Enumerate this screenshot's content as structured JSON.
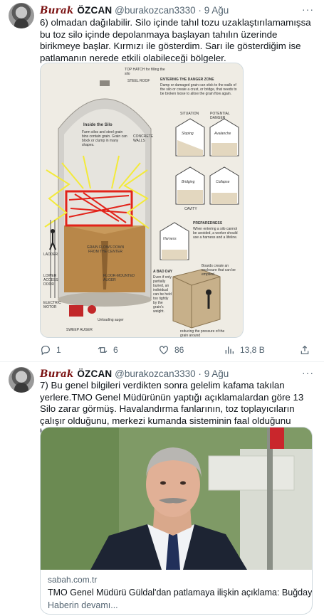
{
  "tweet1": {
    "display_name_styled": "Burak",
    "display_name_plain": "ÖZCAN",
    "handle": "@burakozcan3330",
    "separator": "·",
    "date": "9 Ağu",
    "more": "···",
    "text": "6) olmadan dağılabilir. Silo içinde tahıl tozu uzaklaştırılamamışsa  bu toz silo içinde depolanmaya başlayan tahılın üzerinde birikmeye başlar.  Kırmızı ile gösterdim. Sarı ile gösterdiğim ise patlamanın nerede etkili olabileceği bölgeler.",
    "media": {
      "labels": {
        "top_hatch": "TOP HATCH for filling the silo",
        "steel_roof": "STEEL ROOF",
        "inside": "Inside the Silo",
        "inside_body": "Farm silos and steel grain bins contain grain. Grain can block or clump in many shapes.",
        "concrete": "CONCRETE WALLS",
        "ladder": "LADDER",
        "lower_door": "LOWER ACCESS DOOR",
        "electric": "ELECTRIC MOTOR",
        "auger": "SWEEP AUGER",
        "grain_flows": "GRAIN FLOWS DOWN FROM THE CENTER",
        "floor": "FLOOR-MOUNTED AUGER",
        "unloading": "Unloading auger",
        "entering_title": "ENTERING THE DANGER ZONE",
        "entering_body": "Damp or damaged grain can stick to the walls of the silo or create a crust, or bridge, that needs to be broken loose to allow the grain flow again.",
        "situation": "SITUATION",
        "potential": "POTENTIAL DANGER",
        "sloping": "Sloping",
        "avalanche": "Avalanche",
        "bridging": "Bridging",
        "collapse": "Collapse",
        "cavity": "CAVITY",
        "preparedness_title": "PREPAREDNESS",
        "preparedness_body": "When entering a silo cannot be avoided, a worker should use a harness and a lifeline.",
        "harness": "Harness",
        "bad_day": "A BAD DAY",
        "bad_day_body": "Even if only partially buried, an individual can be held too tightly by the grain's weight.",
        "boards": "Boards create an enclosure that can be emptied.",
        "reducing": "reducing the pressure of the grain around"
      }
    },
    "actions": {
      "replies": "1",
      "retweets": "6",
      "likes": "86",
      "views": "13,8 B"
    }
  },
  "tweet2": {
    "display_name_styled": "Burak",
    "display_name_plain": "ÖZCAN",
    "handle": "@burakozcan3330",
    "separator": "·",
    "date": "9 Ağu",
    "more": "···",
    "text": "7) Bu genel bilgileri verdikten sonra gelelim kafama takılan yerlere.TMO Genel Müdürünün yaptığı açıklamalardan göre  13 Silo zarar görmüş. Havalandırma fanlarının, toz toplayıcıların çalışır olduğunu, merkezi kumanda sisteminin faal olduğunu biliyoruz.",
    "card": {
      "domain": "sabah.com.tr",
      "title": "TMO Genel Müdürü Güldal'dan patlamaya ilişkin açıklama: Buğday ek...",
      "subtitle": "Haberin devamı..."
    }
  },
  "colors": {
    "text": "#0f1419",
    "muted": "#536471",
    "border": "#cfd9de",
    "red_highlight": "#e2231a",
    "yellow_highlight": "#f3ea3a"
  }
}
